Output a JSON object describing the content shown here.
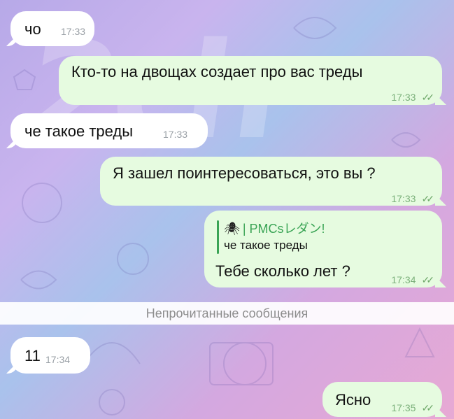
{
  "watermark": "2ch",
  "messages": [
    {
      "text": "чо",
      "time": "17:33"
    },
    {
      "text": "Кто-то на двощах создает про вас треды",
      "time": "17:33",
      "read": "✓✓"
    },
    {
      "text": "че такое треды",
      "time": "17:33"
    },
    {
      "text": "Я зашел поинтересоваться, это вы ?",
      "time": "17:33",
      "read": "✓✓"
    },
    {
      "reply_name": "| PMCsレダン!",
      "reply_icon": "🕷",
      "reply_text": "че такое треды",
      "text": "Тебе сколько лет ?",
      "time": "17:34",
      "read": "✓✓"
    },
    {
      "text": "11",
      "time": "17:34"
    },
    {
      "text": "Ясно",
      "time": "17:35",
      "read": "✓✓"
    }
  ],
  "unread_label": "Непрочитанные сообщения",
  "colors": {
    "incoming": "#ffffff",
    "outgoing": "#e6fbe0",
    "accent": "#3aa455"
  }
}
